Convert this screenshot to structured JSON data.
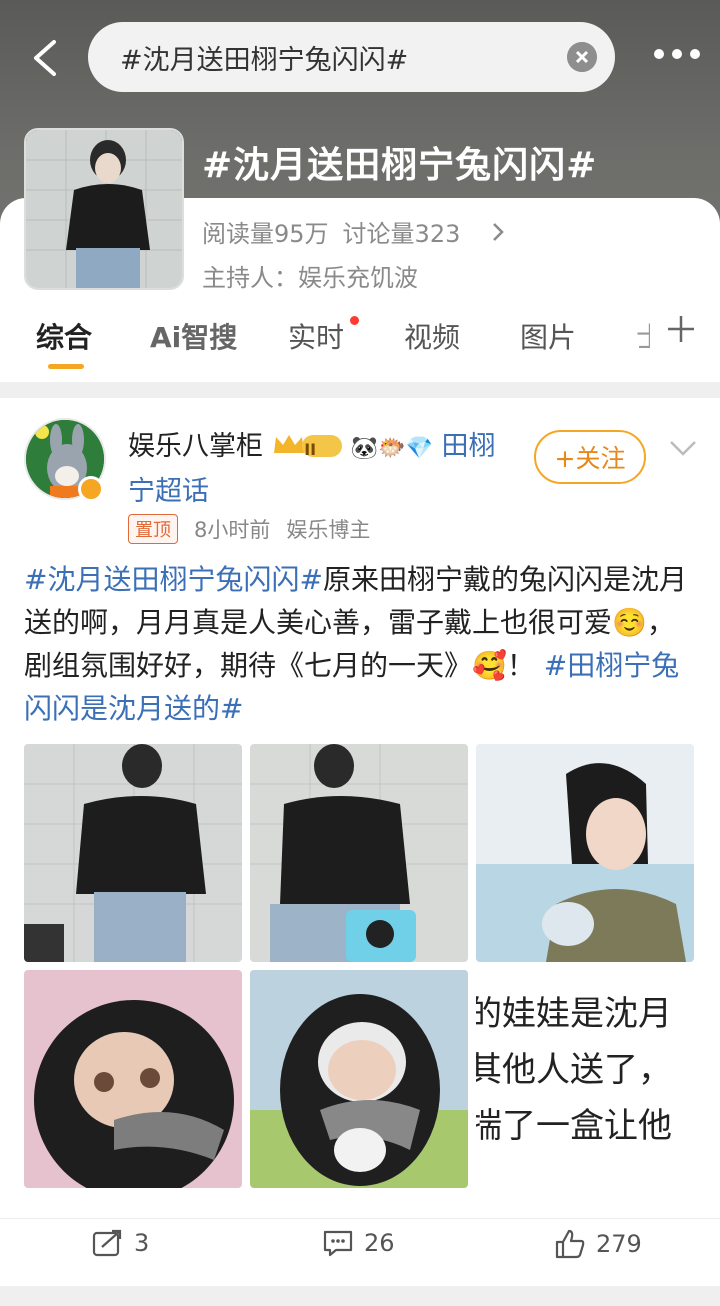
{
  "search": {
    "query": "#沈月送田栩宁兔闪闪#"
  },
  "topic": {
    "title": "#沈月送田栩宁兔闪闪#",
    "reads": "阅读量95万",
    "discussions": "讨论量323",
    "host": "主持人：娱乐充饥波"
  },
  "tabs": [
    {
      "label": "综合"
    },
    {
      "label": "Ai智搜"
    },
    {
      "label": "实时"
    },
    {
      "label": "视频"
    },
    {
      "label": "图片"
    },
    {
      "label": "士"
    }
  ],
  "post": {
    "author": "娱乐八掌柜",
    "crown_label": "II",
    "emoji_badges": "🐼🐡💎",
    "supertopic": "田栩宁超话",
    "follow_label": "+关注",
    "pin_label": "置顶",
    "time": "8小时前",
    "role": "娱乐博主",
    "text_tag1": "#沈月送田栩宁兔闪闪#",
    "text_body1": "原来田栩宁戴的兔闪闪是沈月送的啊，月月真是人美心善，雷子戴上也很可爱☺️，剧组氛围好好，期待《七月的一天》🥰！",
    "text_tag2": "#田栩宁兔闪闪是沈月送的#",
    "image6_lines": [
      "的娃娃是沈月",
      "其他人送了，",
      "揣了一盒让他"
    ],
    "reposts": "3",
    "comments": "26",
    "likes": "279"
  },
  "colors": {
    "accent": "#f5a623",
    "link": "#3b6fb6",
    "header_bg": "#6d6d6a"
  }
}
